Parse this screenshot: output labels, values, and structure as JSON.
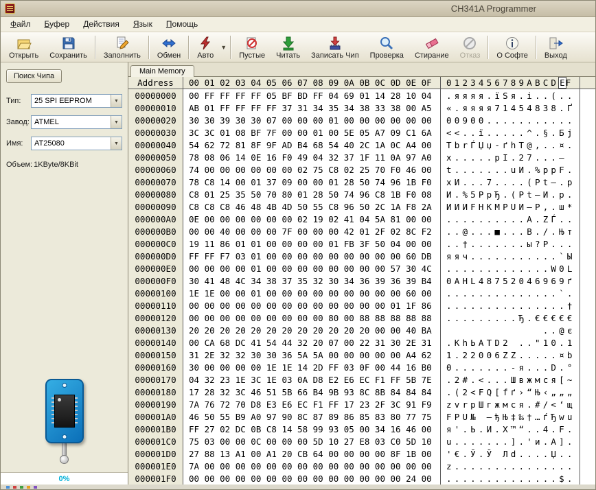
{
  "window": {
    "title": "CH341A Programmer"
  },
  "menu": [
    {
      "label": "Файл"
    },
    {
      "label": "Буфер"
    },
    {
      "label": "Действия"
    },
    {
      "label": "Язык"
    },
    {
      "label": "Помощь"
    }
  ],
  "toolbar": {
    "buttons": [
      {
        "label": "Открыть",
        "icon": "open-folder"
      },
      {
        "label": "Сохранить",
        "icon": "save-floppy"
      },
      {
        "label": "Заполнить",
        "icon": "fill-pencil"
      },
      {
        "label": "Обмен",
        "icon": "swap-arrows"
      },
      {
        "label": "Авто",
        "icon": "auto-lightning",
        "has_dropdown": true
      },
      {
        "label": "Пустые",
        "icon": "blank-check"
      },
      {
        "label": "Читать",
        "icon": "read-arrow"
      },
      {
        "label": "Записать Чип",
        "icon": "write-chip"
      },
      {
        "label": "Проверка",
        "icon": "verify-magnifier"
      },
      {
        "label": "Стирание",
        "icon": "erase-eraser"
      },
      {
        "label": "Отказ",
        "icon": "cancel-prohibit",
        "disabled": true
      },
      {
        "label": "О Софте",
        "icon": "about-info"
      },
      {
        "label": "Выход",
        "icon": "exit-arrow"
      }
    ],
    "dropdown_glyph": "▼"
  },
  "sidebar": {
    "search_button": "Поиск Чипа",
    "type_label": "Тип:",
    "type_value": "25 SPI EEPROM",
    "vendor_label": "Завод:",
    "vendor_value": "ATMEL",
    "name_label": "Имя:",
    "name_value": "AT25080",
    "size_label": "Объем:",
    "size_value": "1KByte/8KBit",
    "combo_arrow": "▼",
    "progress": "0%"
  },
  "memory": {
    "tab": "Main Memory",
    "header": {
      "address": "Address",
      "bytes": "00 01 02 03 04 05 06 07 08 09 0A 0B 0C 0D 0E 0F",
      "ascii_pre": "0123456789ABCD",
      "ascii_cursor": "E",
      "ascii_post": "F"
    },
    "rows": [
      {
        "addr": "00000000",
        "hex": "00 FF FF FF FF 05 BF BD FF 04 69 01 14 28 10 04",
        "ascii": ".яяяя.їЅя.i..(.."
      },
      {
        "addr": "00000010",
        "hex": "AB 01 FF FF FF FF 37 31 34 35 34 38 33 38 00 A5",
        "ascii": "«.яяяя71454838.Ґ"
      },
      {
        "addr": "00000020",
        "hex": "30 30 39 30 30 07 00 00 00 01 00 00 00 00 00 00",
        "ascii": "00900..........."
      },
      {
        "addr": "00000030",
        "hex": "3C 3C 01 08 BF 7F 00 00 01 00 5E 05 A7 09 C1 6A",
        "ascii": "<<..ї.....^.§.Бj"
      },
      {
        "addr": "00000040",
        "hex": "54 62 72 81 8F 9F AD B4 68 54 40 2C 1A 0C A4 00",
        "ascii": "TbrЃЏџ-ґhT@,..¤."
      },
      {
        "addr": "00000050",
        "hex": "78 08 06 14 0E 16 F0 49 04 32 37 1F 11 0A 97 A0",
        "ascii": "x.....рI.27...— "
      },
      {
        "addr": "00000060",
        "hex": "74 00 00 00 00 00 00 02 75 C8 02 25 70 F0 46 00",
        "ascii": "t.......uИ.%pрF."
      },
      {
        "addr": "00000070",
        "hex": "78 C8 14 00 01 37 09 00 00 01 28 50 74 96 1B F0",
        "ascii": "xИ...7....(Pt–.р"
      },
      {
        "addr": "00000080",
        "hex": "C8 01 25 35 50 70 80 01 28 50 74 96 C8 1B F0 08",
        "ascii": "И.%5PpЂ.(Pt–И.р."
      },
      {
        "addr": "00000090",
        "hex": "C8 C8 C8 46 48 4B 4D 50 55 C8 96 50 2C 1A F8 2A",
        "ascii": "ИИИFHKMPUИ–P,.ш*"
      },
      {
        "addr": "000000A0",
        "hex": "0E 00 00 00 00 00 00 02 19 02 41 04 5A 81 00 00",
        "ascii": "..........A.ZЃ.."
      },
      {
        "addr": "000000B0",
        "hex": "00 00 40 00 00 00 7F 00 00 00 42 01 2F 02 8C F2",
        "ascii": "..@...■...B./.Њт"
      },
      {
        "addr": "000000C0",
        "hex": "19 11 86 01 01 00 00 00 00 01 FB 3F 50 04 00 00",
        "ascii": "..†.......ы?P..."
      },
      {
        "addr": "000000D0",
        "hex": "FF FF F7 03 01 00 00 00 00 00 00 00 00 00 60 DB",
        "ascii": "яяч...........`Ы"
      },
      {
        "addr": "000000E0",
        "hex": "00 00 00 00 01 00 00 00 00 00 00 00 00 57 30 4C",
        "ascii": ".............W0L"
      },
      {
        "addr": "000000F0",
        "hex": "30 41 48 4C 34 38 37 35 32 30 34 36 39 36 39 B4",
        "ascii": "0AHL48752046969ґ"
      },
      {
        "addr": "00000100",
        "hex": "1E 1E 00 00 01 00 00 00 00 00 00 00 00 00 60 00",
        "ascii": "..............`."
      },
      {
        "addr": "00000110",
        "hex": "00 00 00 00 00 00 00 00 00 00 00 00 00 01 1F 86",
        "ascii": "...............†"
      },
      {
        "addr": "00000120",
        "hex": "00 00 00 00 00 00 00 00 00 80 00 88 88 88 88 88",
        "ascii": ".........Ђ.€€€€€"
      },
      {
        "addr": "00000130",
        "hex": "20 20 20 20 20 20 20 20 20 20 20 20 00 00 40 BA",
        "ascii": "            ..@є"
      },
      {
        "addr": "00000140",
        "hex": "00 CA 68 DC 41 54 44 32 20 07 00 22 31 30 2E 31",
        "ascii": ".КhЬATD2 ..\"10.1"
      },
      {
        "addr": "00000150",
        "hex": "31 2E 32 32 30 30 36 5A 5A 00 00 00 00 00 A4 62",
        "ascii": "1.22006ZZ.....¤b"
      },
      {
        "addr": "00000160",
        "hex": "30 00 00 00 00 1E 1E 14 2D FF 03 0F 00 44 16 B0",
        "ascii": "0.......-я...D.°"
      },
      {
        "addr": "00000170",
        "hex": "04 32 23 1E 3C 1E 03 0A D8 E2 E6 EC F1 FF 5B 7E",
        "ascii": ".2#.<...Швжмся[~"
      },
      {
        "addr": "00000180",
        "hex": "17 28 32 3C 46 51 5B 66 B4 9B 93 8C 8B 84 84 84",
        "ascii": ".(2<FQ[fґ›“Њ‹„„„"
      },
      {
        "addr": "00000190",
        "hex": "7A 76 72 70 D8 E3 E6 EC F1 FF 17 23 2F 3C 91 F9",
        "ascii": "zvrpШгжмся.#/<‘щ"
      },
      {
        "addr": "000001A0",
        "hex": "46 50 55 B9 A0 97 90 8C 87 89 86 85 83 80 77 75",
        "ascii": "FPU№ —ђЊ‡‰†…ѓЂwu"
      },
      {
        "addr": "000001B0",
        "hex": "FF 27 02 DC 0B C8 14 58 99 93 05 00 34 16 46 00",
        "ascii": "я'.Ь.И.X™“..4.F."
      },
      {
        "addr": "000001C0",
        "hex": "75 03 00 00 0C 00 00 00 5D 10 27 E8 03 C0 5D 10",
        "ascii": "u.......].'и.А]."
      },
      {
        "addr": "000001D0",
        "hex": "27 88 13 A1 00 A1 20 CB 64 00 00 00 00 8F 1B 00",
        "ascii": "'€.Ў.Ў Лd....Џ.."
      },
      {
        "addr": "000001E0",
        "hex": "7A 00 00 00 00 00 00 00 00 00 00 00 00 00 00 00",
        "ascii": "z..............."
      },
      {
        "addr": "000001F0",
        "hex": "00 00 00 00 00 00 00 00 00 00 00 00 00 00 24 00",
        "ascii": "..............$."
      }
    ]
  }
}
